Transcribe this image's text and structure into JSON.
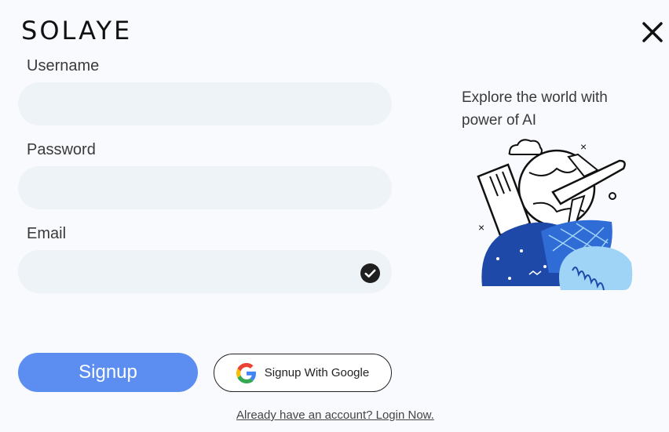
{
  "brand": {
    "logo_text": "SOLAYE"
  },
  "form": {
    "username_label": "Username",
    "password_label": "Password",
    "email_label": "Email",
    "username_value": "",
    "password_value": "",
    "email_value": ""
  },
  "buttons": {
    "signup_label": "Signup",
    "google_label": "Signup With Google"
  },
  "login_link": "Already have an account? Login Now.",
  "side": {
    "tagline": "Explore the world with power of AI"
  },
  "colors": {
    "accent": "#5b8ef0",
    "field_bg": "#eef3f7",
    "illustration_blue": "#1e49a8",
    "illustration_light": "#9fd4f7"
  },
  "icons": {
    "close": "close-icon",
    "valid": "check-circle-icon",
    "google": "google-icon"
  }
}
